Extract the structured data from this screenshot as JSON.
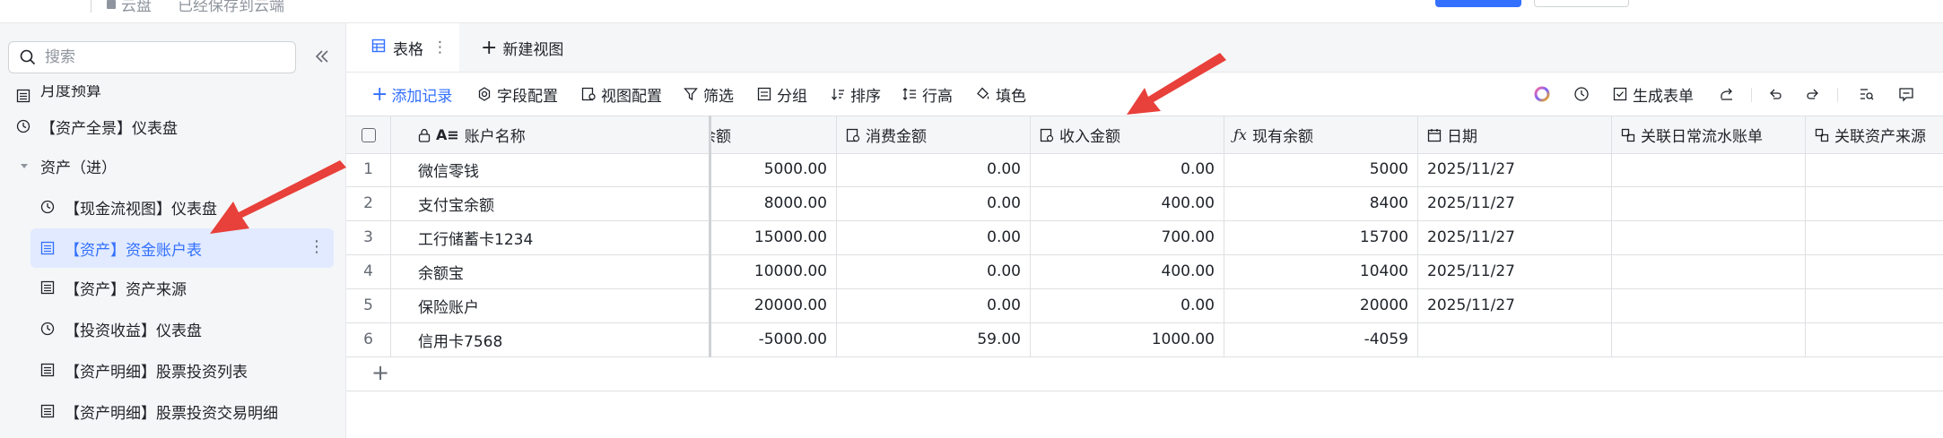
{
  "topbar": {
    "crumb": "云盘",
    "saved": "已经保存到云端"
  },
  "sidebar": {
    "search_placeholder": "搜索",
    "items": [
      {
        "label": "月度预算",
        "icon": "table-icon",
        "indent": 0
      },
      {
        "label": "【资产全景】仪表盘",
        "icon": "dashboard-icon",
        "indent": 0
      },
      {
        "label": "资产（进）",
        "icon": "caret-down-icon",
        "indent": 0
      },
      {
        "label": "【现金流视图】仪表盘",
        "icon": "dashboard-icon",
        "indent": 1
      },
      {
        "label": "【资产】资金账户表",
        "icon": "table-icon",
        "indent": 1,
        "active": true
      },
      {
        "label": "【资产】资产来源",
        "icon": "table-icon",
        "indent": 1
      },
      {
        "label": "【投资收益】仪表盘",
        "icon": "dashboard-icon",
        "indent": 1
      },
      {
        "label": "【资产明细】股票投资列表",
        "icon": "table-icon",
        "indent": 1
      },
      {
        "label": "【资产明细】股票投资交易明细",
        "icon": "table-icon",
        "indent": 1
      }
    ]
  },
  "tabs": {
    "active": "表格",
    "new_view": "新建视图"
  },
  "toolbar": {
    "add_record": "添加记录",
    "field_config": "字段配置",
    "view_config": "视图配置",
    "filter": "筛选",
    "group": "分组",
    "sort": "排序",
    "row_height": "行高",
    "fill": "填色",
    "generate_form": "生成表单"
  },
  "table": {
    "columns": [
      "账户名称",
      "余额",
      "消费金额",
      "收入金额",
      "现有余额",
      "日期",
      "关联日常流水账单",
      "关联资产来源"
    ],
    "rows": [
      {
        "idx": "1",
        "name": "微信零钱",
        "balance": "5000.00",
        "spend": "0.00",
        "income": "0.00",
        "current": "5000",
        "date": "2025/11/27"
      },
      {
        "idx": "2",
        "name": "支付宝余额",
        "balance": "8000.00",
        "spend": "0.00",
        "income": "400.00",
        "current": "8400",
        "date": "2025/11/27"
      },
      {
        "idx": "3",
        "name": "工行储蓄卡1234",
        "balance": "15000.00",
        "spend": "0.00",
        "income": "700.00",
        "current": "15700",
        "date": "2025/11/27"
      },
      {
        "idx": "4",
        "name": "余额宝",
        "balance": "10000.00",
        "spend": "0.00",
        "income": "400.00",
        "current": "10400",
        "date": "2025/11/27"
      },
      {
        "idx": "5",
        "name": "保险账户",
        "balance": "20000.00",
        "spend": "0.00",
        "income": "0.00",
        "current": "20000",
        "date": "2025/11/27"
      },
      {
        "idx": "6",
        "name": "信用卡7568",
        "balance": "-5000.00",
        "spend": "59.00",
        "income": "1000.00",
        "current": "-4059",
        "date": ""
      }
    ]
  },
  "colors": {
    "accent": "#3370ff",
    "arrow": "#e8403a",
    "active_bg": "#e1eaff"
  }
}
